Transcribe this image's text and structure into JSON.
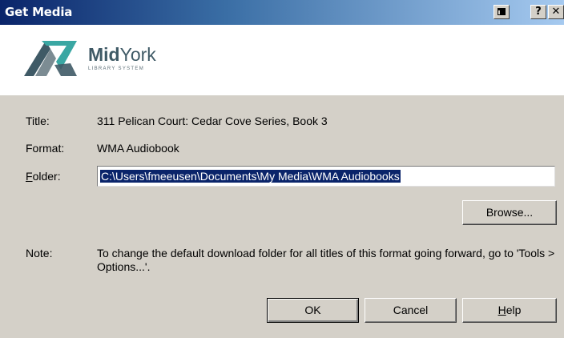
{
  "window": {
    "title": "Get Media",
    "help_button": "?",
    "close_button": "✕"
  },
  "branding": {
    "name_part1": "Mid",
    "name_part2": "York",
    "tagline": "LIBRARY SYSTEM",
    "colors": {
      "logo_dark": "#3f5a66",
      "logo_teal": "#3aa7a3",
      "logo_gray": "#7c8c93"
    }
  },
  "form": {
    "title_label": "Title:",
    "title_value": "311 Pelican Court: Cedar Cove Series, Book 3",
    "format_label": "Format:",
    "format_value": "WMA Audiobook",
    "folder_label_first": "F",
    "folder_label_rest": "older:",
    "folder_value": "C:\\Users\\fmeeusen\\Documents\\My Media\\WMA Audiobooks",
    "browse_label": "Browse...",
    "note_label": "Note:",
    "note_text": "To change the default download folder for all titles of this format going forward, go to 'Tools > Options...'."
  },
  "buttons": {
    "ok_label": "OK",
    "cancel_label": "Cancel",
    "help_first": "H",
    "help_rest": "elp"
  }
}
